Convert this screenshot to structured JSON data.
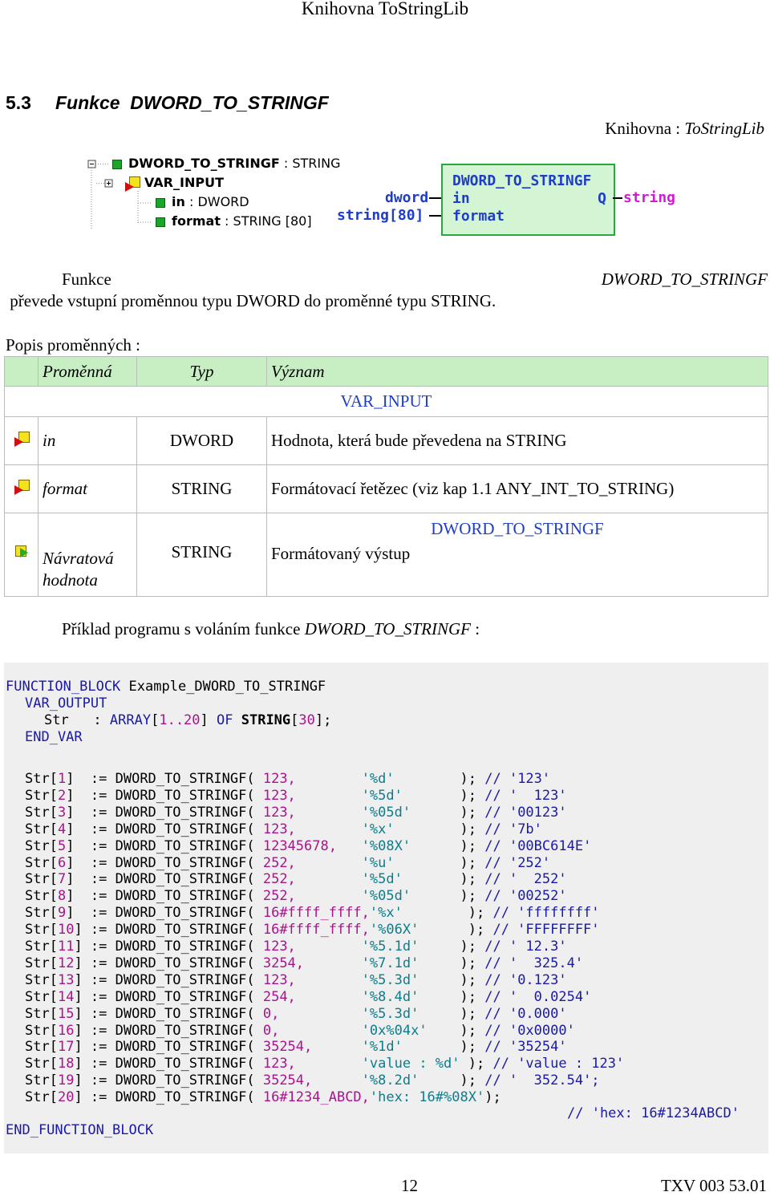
{
  "header": "Knihovna ToStringLib",
  "section": {
    "number": "5.3",
    "title": "Funkce  DWORD_TO_STRINGF"
  },
  "library_line": {
    "prefix": "Knihovna : ",
    "name": "ToStringLib"
  },
  "tree": {
    "root_name": "DWORD_TO_STRINGF",
    "root_type": " : STRING",
    "group": "VAR_INPUT",
    "item1_name": "in",
    "item1_type": " : DWORD",
    "item2_name": "format",
    "item2_type": " : STRING [80]"
  },
  "block": {
    "title": "DWORD_TO_STRINGF",
    "in_pin": "in",
    "format_pin": "format",
    "out_pin": "Q",
    "in_type": "dword",
    "format_type": "string[80]",
    "out_type": "string"
  },
  "description": {
    "p1": "Funkce ",
    "func": "DWORD_TO_STRINGF",
    "p2": " převede vstupní proměnnou typu DWORD do proměnné typu STRING."
  },
  "vars_title": "Popis proměnných :",
  "table": {
    "col1": "Proměnná",
    "col2": "Typ",
    "col3": "Význam",
    "section1": "VAR_INPUT",
    "row1": {
      "name": "in",
      "type": "DWORD",
      "desc": "Hodnota, která bude převedena na STRING"
    },
    "row2": {
      "name": "format",
      "type": "STRING",
      "desc": "Formátovací řetězec (viz kap 1.1 ANY_INT_TO_STRING)"
    },
    "section2": "DWORD_TO_STRINGF",
    "row3": {
      "name": "Návratová hodnota",
      "type": "STRING",
      "desc": "Formátovaný výstup"
    }
  },
  "example_intro": {
    "p1": "Příklad programu s voláním funkce ",
    "func": "DWORD_TO_STRINGF",
    "p2": " :"
  },
  "code": {
    "fb_kw": "FUNCTION_BLOCK",
    "fb_name": " Example_DWORD_TO_STRINGF",
    "var_output": "VAR_OUTPUT",
    "str_decl": "Str",
    "str_decl_mid": "   : ",
    "array_kw": "ARRAY",
    "array_lb": "[",
    "array_range": "1..20",
    "array_rb": "] ",
    "of_kw": "OF",
    "string_kw": " STRING",
    "string_lb": "[",
    "string_len": "30",
    "string_rb": "];",
    "end_var": "END_VAR",
    "func": "DWORD_TO_STRINGF",
    "lines": [
      {
        "idx": "1",
        "pad": " ",
        "arg": "123,",
        "argpad": "        ",
        "fmt": "'%d'",
        "fmtpad": "        ",
        "res": "'123'"
      },
      {
        "idx": "2",
        "pad": " ",
        "arg": "123,",
        "argpad": "        ",
        "fmt": "'%5d'",
        "fmtpad": "       ",
        "res": "'  123'"
      },
      {
        "idx": "3",
        "pad": " ",
        "arg": "123,",
        "argpad": "        ",
        "fmt": "'%05d'",
        "fmtpad": "      ",
        "res": "'00123'"
      },
      {
        "idx": "4",
        "pad": " ",
        "arg": "123,",
        "argpad": "        ",
        "fmt": "'%x'",
        "fmtpad": "        ",
        "res": "'7b'"
      },
      {
        "idx": "5",
        "pad": " ",
        "arg": "12345678,",
        "argpad": "   ",
        "fmt": "'%08X'",
        "fmtpad": "      ",
        "res": "'00BC614E'"
      },
      {
        "idx": "6",
        "pad": " ",
        "arg": "252,",
        "argpad": "        ",
        "fmt": "'%u'",
        "fmtpad": "        ",
        "res": "'252'"
      },
      {
        "idx": "7",
        "pad": " ",
        "arg": "252,",
        "argpad": "        ",
        "fmt": "'%5d'",
        "fmtpad": "       ",
        "res": "'  252'"
      },
      {
        "idx": "8",
        "pad": " ",
        "arg": "252,",
        "argpad": "        ",
        "fmt": "'%05d'",
        "fmtpad": "      ",
        "res": "'00252'"
      },
      {
        "idx": "9",
        "pad": " ",
        "arg": "16#ffff_ffff,",
        "argpad": "",
        "fmt": "'%x'",
        "fmtpad": "        ",
        "res": "'ffffffff'"
      },
      {
        "idx": "10",
        "pad": "",
        "arg": "16#ffff_ffff,",
        "argpad": "",
        "fmt": "'%06X'",
        "fmtpad": "      ",
        "res": "'FFFFFFFF'"
      },
      {
        "idx": "11",
        "pad": "",
        "arg": "123,",
        "argpad": "        ",
        "fmt": "'%5.1d'",
        "fmtpad": "     ",
        "res": "' 12.3'"
      },
      {
        "idx": "12",
        "pad": "",
        "arg": "3254,",
        "argpad": "       ",
        "fmt": "'%7.1d'",
        "fmtpad": "     ",
        "res": "'  325.4'"
      },
      {
        "idx": "13",
        "pad": "",
        "arg": "123,",
        "argpad": "        ",
        "fmt": "'%5.3d'",
        "fmtpad": "     ",
        "res": "'0.123'"
      },
      {
        "idx": "14",
        "pad": "",
        "arg": "254,",
        "argpad": "        ",
        "fmt": "'%8.4d'",
        "fmtpad": "     ",
        "res": "'  0.0254'"
      },
      {
        "idx": "15",
        "pad": "",
        "arg": "0,",
        "argpad": "          ",
        "fmt": "'%5.3d'",
        "fmtpad": "     ",
        "res": "'0.000'"
      },
      {
        "idx": "16",
        "pad": "",
        "arg": "0,",
        "argpad": "          ",
        "fmt": "'0x%04x'",
        "fmtpad": "    ",
        "res": "'0x0000'"
      },
      {
        "idx": "17",
        "pad": "",
        "arg": "35254,",
        "argpad": "      ",
        "fmt": "'%1d'",
        "fmtpad": "       ",
        "res": "'35254'"
      },
      {
        "idx": "18",
        "pad": "",
        "arg": "123,",
        "argpad": "        ",
        "fmt": "'value : %d'",
        "fmtpad": " ",
        "res": "'value : 123'"
      },
      {
        "idx": "19",
        "pad": "",
        "arg": "35254,",
        "argpad": "      ",
        "fmt": "'%8.2d'",
        "fmtpad": "     ",
        "res": "'  352.54';"
      },
      {
        "idx": "20",
        "pad": "",
        "arg": "16#1234_ABCD,",
        "argpad": "",
        "fmt": "'hex: 16#%08X'",
        "fmtpad": "",
        "res": "",
        "tail": ");"
      }
    ],
    "last_comment": "// 'hex: 16#1234ABCD'",
    "end_fb": "END_FUNCTION_BLOCK"
  },
  "footer": {
    "page": "12",
    "doc": "TXV 003 53.01"
  }
}
